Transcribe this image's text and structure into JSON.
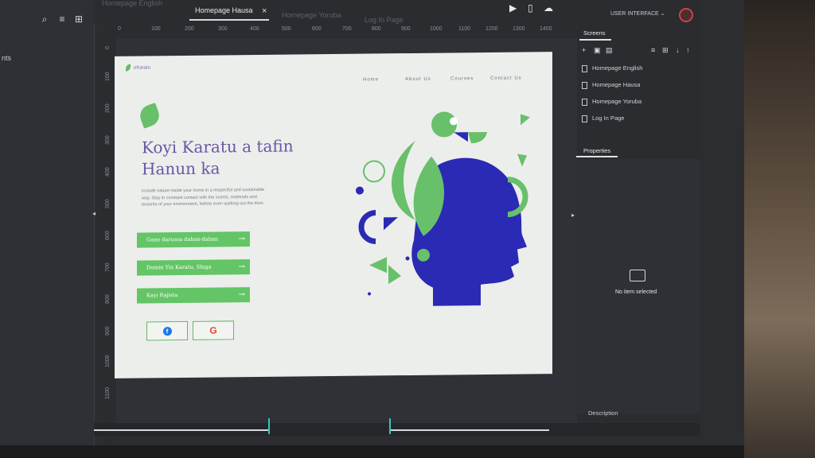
{
  "left_panel": {
    "label": "nts"
  },
  "tabs": [
    {
      "label": "Homepage English",
      "active": false
    },
    {
      "label": "Homepage Hausa",
      "active": true
    },
    {
      "label": "Homepage Yoruba",
      "active": false
    },
    {
      "label": "Log In Page",
      "active": false
    }
  ],
  "tab_close": "×",
  "ruler_top": [
    "0",
    "100",
    "200",
    "300",
    "400",
    "500",
    "600",
    "700",
    "800",
    "900",
    "1000",
    "1100",
    "1200",
    "1300",
    "1400"
  ],
  "ruler_left": [
    "0",
    "100",
    "200",
    "300",
    "400",
    "500",
    "600",
    "700",
    "800",
    "900",
    "1000",
    "1100"
  ],
  "site": {
    "logo": "eKaratu",
    "nav": [
      "Home",
      "About Us",
      "Courses",
      "Contact Us"
    ],
    "hero_title": "Koyi Karatu a tafin Hanun ka",
    "hero_text": "Include nature inside your home in a respectful and sustainable way. Stay in constant contact with the scents, materials and textures of your environment, before even walking out the door.",
    "buttons": [
      "Gano darussa daban-daban",
      "Domin Yin Karatu, Shiga",
      "Kayi Rajista"
    ],
    "button_arrow": "→",
    "social": {
      "facebook": "f",
      "google": "G"
    }
  },
  "right_panel": {
    "header": "USER INTERFACE ⌄",
    "screens_tab": "Screens",
    "screens": [
      "Homepage English",
      "Homepage Hausa",
      "Homepage Yoruba",
      "Log In Page"
    ],
    "properties_tab": "Properties",
    "no_selection": "No item selected",
    "description": "Description"
  },
  "colors": {
    "accent_green": "#63c566",
    "accent_purple": "#6a56a4",
    "accent_blue": "#2a2ab5"
  }
}
